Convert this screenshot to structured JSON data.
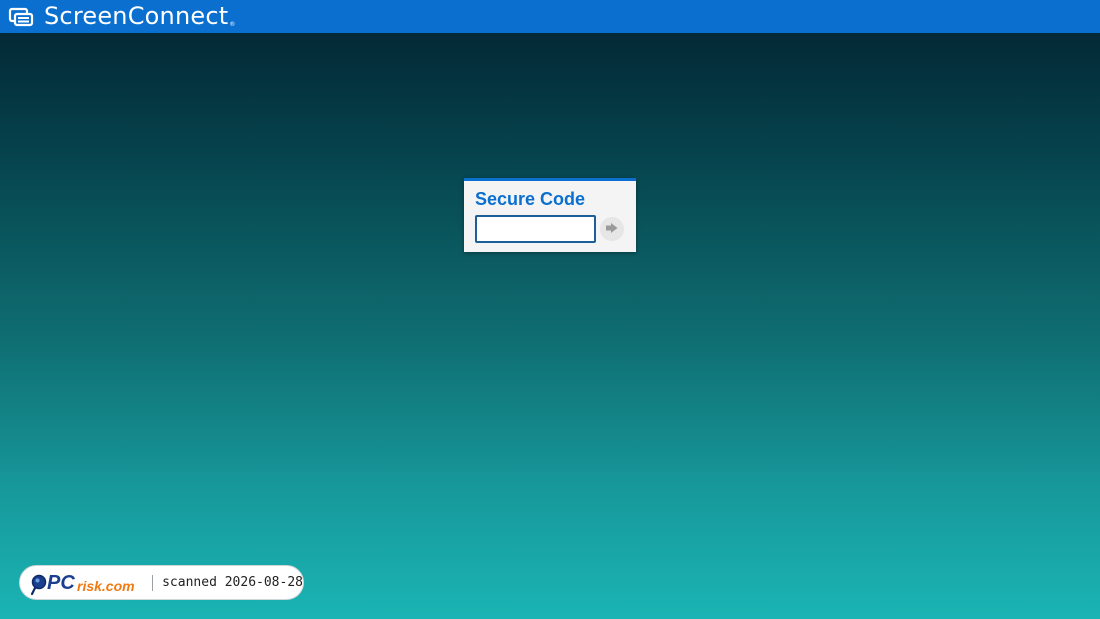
{
  "header": {
    "brand_name": "ScreenConnect",
    "trademark": "®",
    "logo_icon": "screenconnect-logo-icon",
    "background_color": "#0b6fcf"
  },
  "login": {
    "title": "Secure Code",
    "input_value": "",
    "submit_icon": "arrow-right-icon",
    "accent_color": "#0b6fcf"
  },
  "watermark": {
    "logo_text": "PCrisk.com",
    "text": "scanned 2026-08-28"
  }
}
